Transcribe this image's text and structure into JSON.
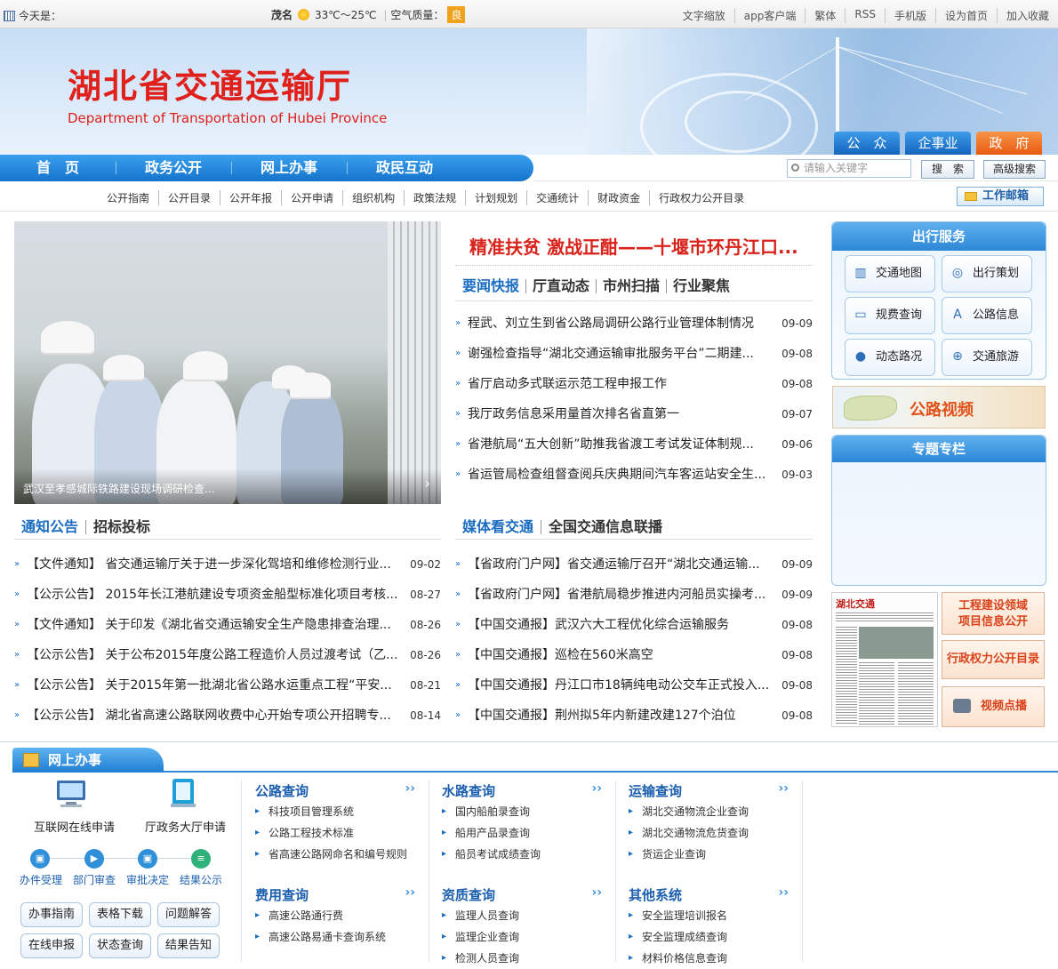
{
  "topbar": {
    "today_label": "今天是：",
    "city": "茂名",
    "temperature": "33℃～25℃",
    "aqi_label": "空气质量：",
    "aqi_value": "良",
    "links": [
      "文字缩放",
      "app客户端",
      "繁体",
      "RSS",
      "手机版",
      "设为首页",
      "加入收藏"
    ]
  },
  "banner": {
    "title_cn": "湖北省交通运输厅",
    "title_en": "Department of Transportation of Hubei Province",
    "user_tabs": [
      "公　众",
      "企事业",
      "政　府"
    ]
  },
  "nav": {
    "items": [
      "首　页",
      "政务公开",
      "网上办事",
      "政民互动"
    ],
    "search_placeholder": "请输入关键字",
    "search_btn": "搜　索",
    "advanced_btn": "高级搜索"
  },
  "subnav": {
    "items": [
      "公开指南",
      "公开目录",
      "公开年报",
      "公开申请",
      "组织机构",
      "政策法规",
      "计划规划",
      "交通统计",
      "财政资金",
      "行政权力公开目录"
    ],
    "mailbox": "工作邮箱"
  },
  "slide": {
    "caption": "武汉至孝感城际铁路建设现场调研检查..."
  },
  "headline": "精准扶贫 激战正酣——十堰市环丹江口...",
  "news_tabs": [
    "要闻快报",
    "厅直动态",
    "市州扫描",
    "行业聚焦"
  ],
  "news": [
    {
      "title": "程武、刘立生到省公路局调研公路行业管理体制情况",
      "date": "09-09"
    },
    {
      "title": "谢强检查指导“湖北交通运输审批服务平台”二期建...",
      "date": "09-08"
    },
    {
      "title": "省厅启动多式联运示范工程申报工作",
      "date": "09-08"
    },
    {
      "title": "我厅政务信息采用量首次排名省直第一",
      "date": "09-07"
    },
    {
      "title": "省港航局“五大创新”助推我省渡工考试发证体制规...",
      "date": "09-06"
    },
    {
      "title": "省运管局检查组督查阅兵庆典期间汽车客运站安全生...",
      "date": "09-03"
    }
  ],
  "notice_tabs": [
    "通知公告",
    "招标投标"
  ],
  "notices": [
    {
      "title": "【文件通知】 省交通运输厅关于进一步深化驾培和维修检测行业...",
      "date": "09-02"
    },
    {
      "title": "【公示公告】 2015年长江港航建设专项资金船型标准化项目考核...",
      "date": "08-27"
    },
    {
      "title": "【文件通知】 关于印发《湖北省交通运输安全生产隐患排查治理...",
      "date": "08-26"
    },
    {
      "title": "【公示公告】 关于公布2015年度公路工程造价人员过渡考试（乙...",
      "date": "08-26"
    },
    {
      "title": "【公示公告】 关于2015年第一批湖北省公路水运重点工程“平安...",
      "date": "08-21"
    },
    {
      "title": "【公示公告】 湖北省高速公路联网收费中心开始专项公开招聘专...",
      "date": "08-14"
    }
  ],
  "media_tabs": [
    "媒体看交通",
    "全国交通信息联播"
  ],
  "media": [
    {
      "title": "【省政府门户网】省交通运输厅召开“湖北交通运输...",
      "date": "09-09"
    },
    {
      "title": "【省政府门户网】省港航局稳步推进内河船员实操考...",
      "date": "09-09"
    },
    {
      "title": "【中国交通报】武汉六大工程优化综合运输服务",
      "date": "09-08"
    },
    {
      "title": "【中国交通报】巡检在560米高空",
      "date": "09-08"
    },
    {
      "title": "【中国交通报】丹江口市18辆纯电动公交车正式投入...",
      "date": "09-08"
    },
    {
      "title": "【中国交通报】荆州拟5年内新建改建127个泊位",
      "date": "09-08"
    }
  ],
  "travel": {
    "title": "出行服务",
    "items": [
      {
        "label": "交通地图",
        "icon": "map-icon"
      },
      {
        "label": "出行策划",
        "icon": "compass-icon"
      },
      {
        "label": "规费查询",
        "icon": "card-icon"
      },
      {
        "label": "公路信息",
        "icon": "road-icon"
      },
      {
        "label": "动态路况",
        "icon": "location-pin-icon"
      },
      {
        "label": "交通旅游",
        "icon": "globe-icon"
      }
    ]
  },
  "video_banner": "公路视频",
  "special_title": "专题专栏",
  "newspaper_masthead": "湖北交通",
  "side_buttons": [
    "工程建设领域\n项目信息公开",
    "行政权力公开目录",
    "视频点播"
  ],
  "online": {
    "title": "网上办事",
    "apply": [
      "互联网在线申请",
      "厅政务大厅申请"
    ],
    "steps": [
      "办件受理",
      "部门审查",
      "审批决定",
      "结果公示"
    ],
    "pills": [
      "办事指南",
      "表格下载",
      "问题解答",
      "在线申报",
      "状态查询",
      "结果告知"
    ],
    "columns": [
      {
        "title": "公路查询",
        "items": [
          "科技项目管理系统",
          "公路工程技术标准",
          "省高速公路网命名和编号规则"
        ]
      },
      {
        "title": "水路查询",
        "items": [
          "国内船舶录查询",
          "船用产品录查询",
          "船员考试成绩查询"
        ]
      },
      {
        "title": "运输查询",
        "items": [
          "湖北交通物流企业查询",
          "湖北交通物流危货查询",
          "货运企业查询"
        ]
      },
      {
        "title": "费用查询",
        "items": [
          "高速公路通行费",
          "高速公路易通卡查询系统"
        ]
      },
      {
        "title": "资质查询",
        "items": [
          "监理人员查询",
          "监理企业查询",
          "检测人员查询"
        ]
      },
      {
        "title": "其他系统",
        "items": [
          "安全监理培训报名",
          "安全监理成绩查询",
          "材料价格信息查询"
        ]
      }
    ],
    "more": "››"
  },
  "colors": {
    "brand_red": "#e0201b",
    "nav_blue": "#1b6dc1",
    "tab_public": "#1e7fd2",
    "tab_enterprise": "#1e7fd2",
    "tab_government": "#f0681a"
  }
}
